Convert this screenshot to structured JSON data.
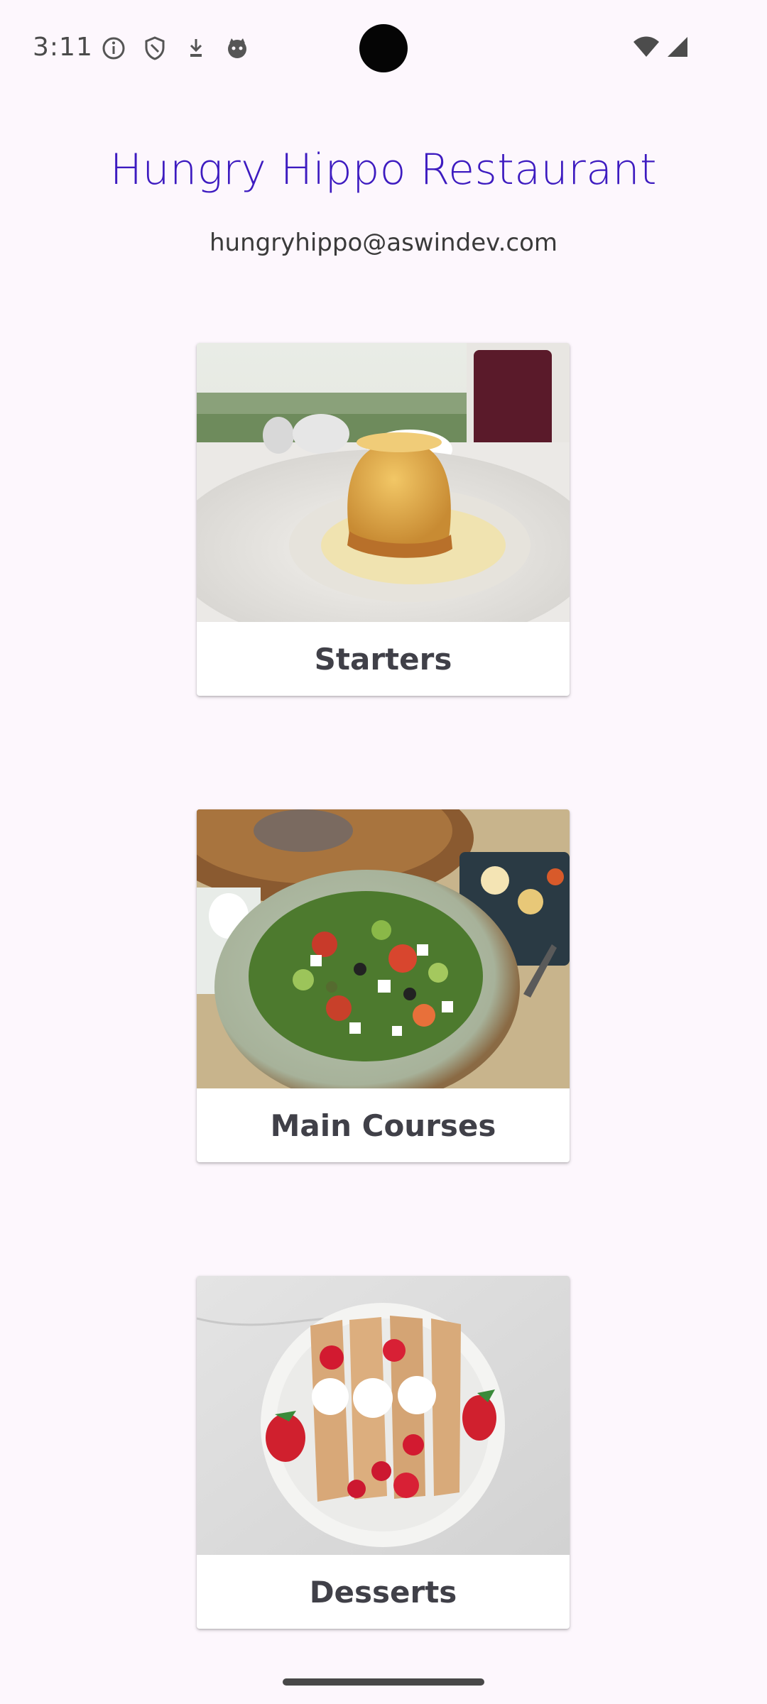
{
  "status_bar": {
    "time": "3:11",
    "icons_left": [
      "info-icon",
      "shield-icon",
      "download-icon",
      "cat-icon"
    ],
    "icons_right": [
      "wifi-icon",
      "signal-icon"
    ]
  },
  "header": {
    "title": "Hungry Hippo Restaurant",
    "email": "hungryhippo@aswindev.com"
  },
  "categories": [
    {
      "label": "Starters",
      "image": "souffle-dessert-plate"
    },
    {
      "label": "Main Courses",
      "image": "greek-salad-bowl"
    },
    {
      "label": "Desserts",
      "image": "crepes-strawberries-cream"
    }
  ],
  "colors": {
    "background": "#fdf7fd",
    "title": "#3d1bc0",
    "card_label": "#404048"
  }
}
